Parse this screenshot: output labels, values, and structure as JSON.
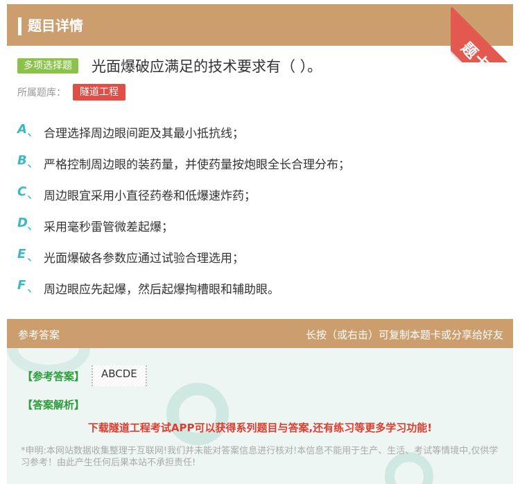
{
  "header": {
    "title": "题目详情"
  },
  "ribbon": {
    "label": "题卡"
  },
  "question": {
    "type_badge": "多项选择题",
    "text": "光面爆破应满足的技术要求有（ ）。",
    "bank_label": "所属题库：",
    "bank_name": "隧道工程"
  },
  "options": [
    {
      "letter": "A",
      "sep": "、",
      "text": "合理选择周边眼间距及其最小抵抗线；"
    },
    {
      "letter": "B",
      "sep": "、",
      "text": "严格控制周边眼的装药量，并使药量按炮眼全长合理分布；"
    },
    {
      "letter": "C",
      "sep": "、",
      "text": "周边眼宜采用小直径药卷和低爆速炸药；"
    },
    {
      "letter": "D",
      "sep": "、",
      "text": "采用毫秒雷管微差起爆；"
    },
    {
      "letter": "E",
      "sep": "、",
      "text": "光面爆破各参数应通过试验合理选用；"
    },
    {
      "letter": "F",
      "sep": "、",
      "text": "周边眼应先起爆，然后起爆掏槽眼和辅助眼。"
    }
  ],
  "answer": {
    "header_left": "参考答案",
    "header_right": "长按（或右击）可复制本题卡或分享给好友",
    "ref_label": "【参考答案】",
    "ref_value": "ABCDE",
    "analysis_label": "【答案解析】",
    "download": "下载隧道工程考试APP可以获得系列题目与答案,还有练习等更多学习功能!",
    "notice": "*申明:本网站数据收集整理于互联网!我们并未能对答案信息进行核对!本信息不能用于生产、生活、考试等情境中,仅供学习参考！由此产生任何后果本站不承担责任!"
  },
  "colors": {
    "header_bg": "#cd9e6d",
    "ribbon": "#e35950",
    "type_badge": "#8bc34a",
    "bank_tag": "#e04e46",
    "option_letter": "#3ab8c4",
    "answer_label": "#2b9c3a",
    "download_text": "#e23b2e"
  }
}
